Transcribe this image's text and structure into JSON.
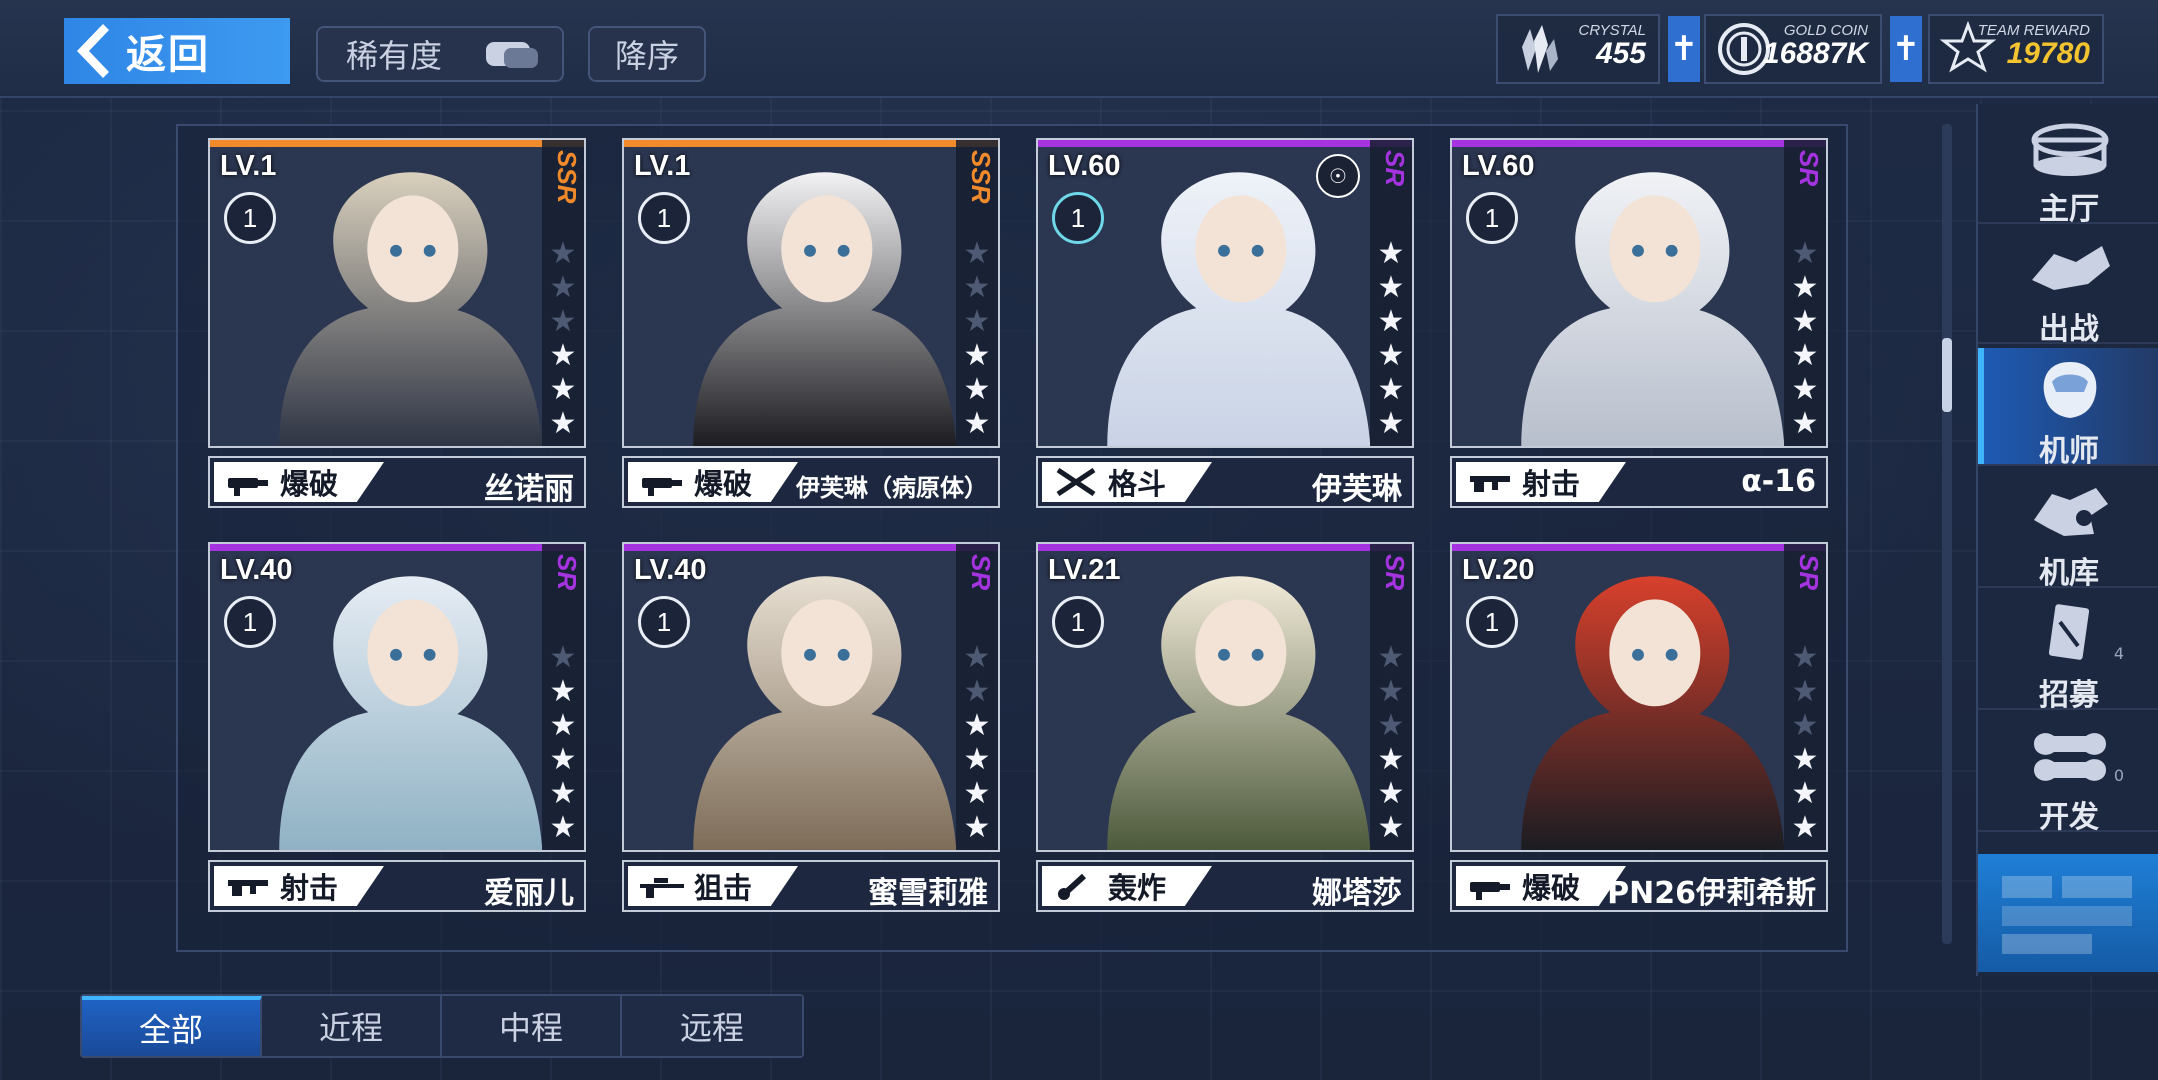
{
  "header": {
    "back_label": "返回",
    "sort_rarity_label": "稀有度",
    "sort_order_label": "降序"
  },
  "resources": {
    "crystal": {
      "tag": "CRYSTAL",
      "value": "455"
    },
    "gold": {
      "tag": "GOLD COIN",
      "value": "16887K"
    },
    "team": {
      "tag": "TEAM REWARD",
      "value": "19780"
    },
    "plus_label": "✝"
  },
  "cards": [
    {
      "level": "LV.1",
      "badge": "1",
      "rank": "SSR",
      "stars_on": 3,
      "stars_total": 6,
      "type": "爆破",
      "type_icon": "demolition-icon",
      "name": "丝诺丽"
    },
    {
      "level": "LV.1",
      "badge": "1",
      "rank": "SSR",
      "stars_on": 3,
      "stars_total": 6,
      "type": "爆破",
      "type_icon": "demolition-icon",
      "name": "伊芙琳（病原体）"
    },
    {
      "level": "LV.60",
      "badge": "1",
      "rank": "SR",
      "stars_on": 6,
      "stars_total": 6,
      "type": "格斗",
      "type_icon": "melee-icon",
      "name": "伊芙琳"
    },
    {
      "level": "LV.60",
      "badge": "1",
      "rank": "SR",
      "stars_on": 5,
      "stars_total": 6,
      "type": "射击",
      "type_icon": "rifle-icon",
      "name": "α-16"
    },
    {
      "level": "LV.40",
      "badge": "1",
      "rank": "SR",
      "stars_on": 5,
      "stars_total": 6,
      "type": "射击",
      "type_icon": "rifle-icon",
      "name": "爱丽儿"
    },
    {
      "level": "LV.40",
      "badge": "1",
      "rank": "SR",
      "stars_on": 4,
      "stars_total": 6,
      "type": "狙击",
      "type_icon": "sniper-icon",
      "name": "蜜雪莉雅"
    },
    {
      "level": "LV.21",
      "badge": "1",
      "rank": "SR",
      "stars_on": 3,
      "stars_total": 6,
      "type": "轰炸",
      "type_icon": "bomb-icon",
      "name": "娜塔莎"
    },
    {
      "level": "LV.20",
      "badge": "1",
      "rank": "SR",
      "stars_on": 3,
      "stars_total": 6,
      "type": "爆破",
      "type_icon": "demolition-icon",
      "name": "PN26伊莉希斯"
    }
  ],
  "sidebar": {
    "items": [
      {
        "label": "主厅"
      },
      {
        "label": "出战"
      },
      {
        "label": "机师"
      },
      {
        "label": "机库"
      },
      {
        "label": "招募",
        "count": "4"
      },
      {
        "label": "开发",
        "count": "0"
      }
    ]
  },
  "tabs": [
    {
      "label": "全部"
    },
    {
      "label": "近程"
    },
    {
      "label": "中程"
    },
    {
      "label": "远程"
    }
  ],
  "colors": {
    "ssr": "#f08a2a",
    "sr": "#a533e0",
    "accent": "#2f86e6"
  }
}
